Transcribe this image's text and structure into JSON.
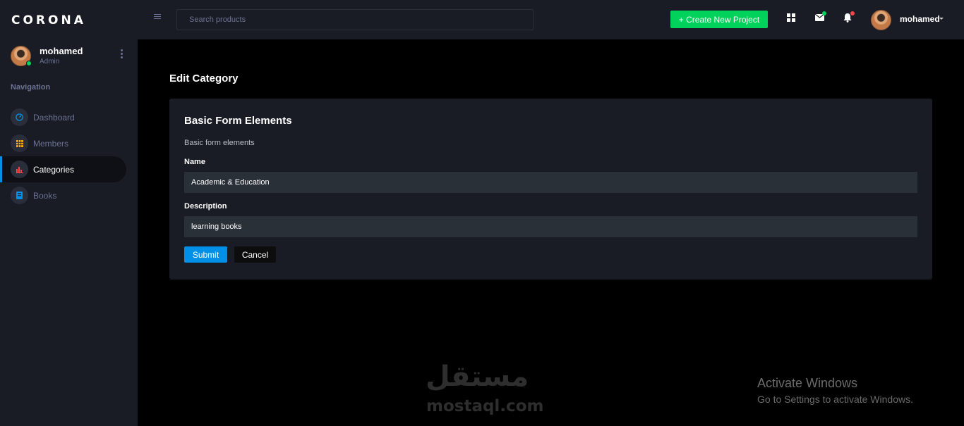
{
  "brand": "CORONA",
  "sidebar": {
    "user_name": "mohamed",
    "user_role": "Admin",
    "nav_heading": "Navigation",
    "items": [
      {
        "label": "Dashboard",
        "icon": "speedometer-icon",
        "color": "#0090e7"
      },
      {
        "label": "Members",
        "icon": "grid-icon",
        "color": "#ffab00"
      },
      {
        "label": "Categories",
        "icon": "bar-chart-icon",
        "color": "#fc424a"
      },
      {
        "label": "Books",
        "icon": "book-icon",
        "color": "#0090e7"
      }
    ],
    "active_item": "Categories"
  },
  "topbar": {
    "search_placeholder": "Search products",
    "create_label": "+ Create New Project",
    "user_name": "mohamed",
    "icons": [
      "apps-icon",
      "mail-icon",
      "bell-icon"
    ]
  },
  "page": {
    "title": "Edit Category",
    "card_title": "Basic Form Elements",
    "card_description": "Basic form elements",
    "name_label": "Name",
    "name_value": "Academic & Education",
    "description_label": "Description",
    "description_value": "learning books",
    "submit_label": "Submit",
    "cancel_label": "Cancel"
  },
  "watermark": {
    "arabic": "مستقل",
    "latin": "mostaql.com"
  },
  "windows_activation": {
    "title": "Activate Windows",
    "subtitle": "Go to Settings to activate Windows."
  },
  "colors": {
    "success": "#00d25b",
    "primary": "#0090e7",
    "danger": "#fc424a",
    "warning": "#ffab00",
    "sidebar_bg": "#191c24"
  }
}
